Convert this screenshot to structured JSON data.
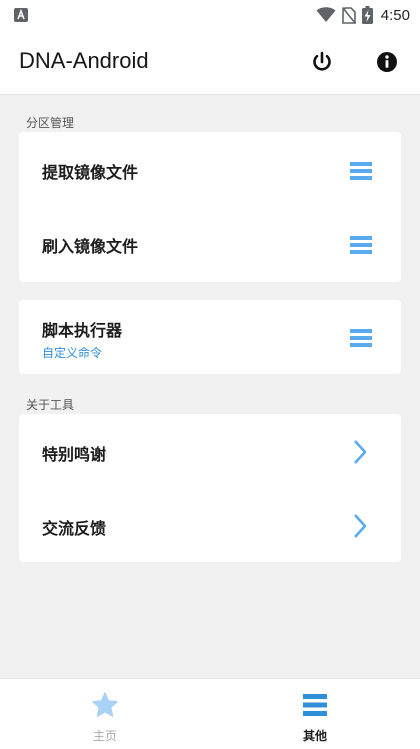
{
  "status_bar": {
    "time": "4:50",
    "notification_icon": "a-box-icon",
    "icons": [
      "wifi-icon",
      "no-sim-icon",
      "battery-charging-icon"
    ]
  },
  "app_bar": {
    "title": "DNA-Android",
    "actions": [
      "power-icon",
      "info-icon"
    ]
  },
  "sections": [
    {
      "label": "分区管理",
      "cards": [
        {
          "items": [
            {
              "title": "提取镜像文件",
              "icon": "menu-icon"
            },
            {
              "title": "刷入镜像文件",
              "icon": "menu-icon"
            }
          ]
        },
        {
          "items": [
            {
              "title": "脚本执行器",
              "subtitle": "自定义命令",
              "icon": "menu-icon"
            }
          ]
        }
      ]
    },
    {
      "label": "关于工具",
      "cards": [
        {
          "items": [
            {
              "title": "特别鸣谢",
              "icon": "chevron-right-icon"
            },
            {
              "title": "交流反馈",
              "icon": "chevron-right-icon"
            }
          ]
        }
      ]
    }
  ],
  "bottom_nav": {
    "items": [
      {
        "label": "主页",
        "icon": "star-icon",
        "active": false
      },
      {
        "label": "其他",
        "icon": "menu-icon",
        "active": true
      }
    ]
  },
  "colors": {
    "accent": "#5aaaf0",
    "subtitle": "#2f8fd8",
    "background": "#f1f1f1"
  }
}
